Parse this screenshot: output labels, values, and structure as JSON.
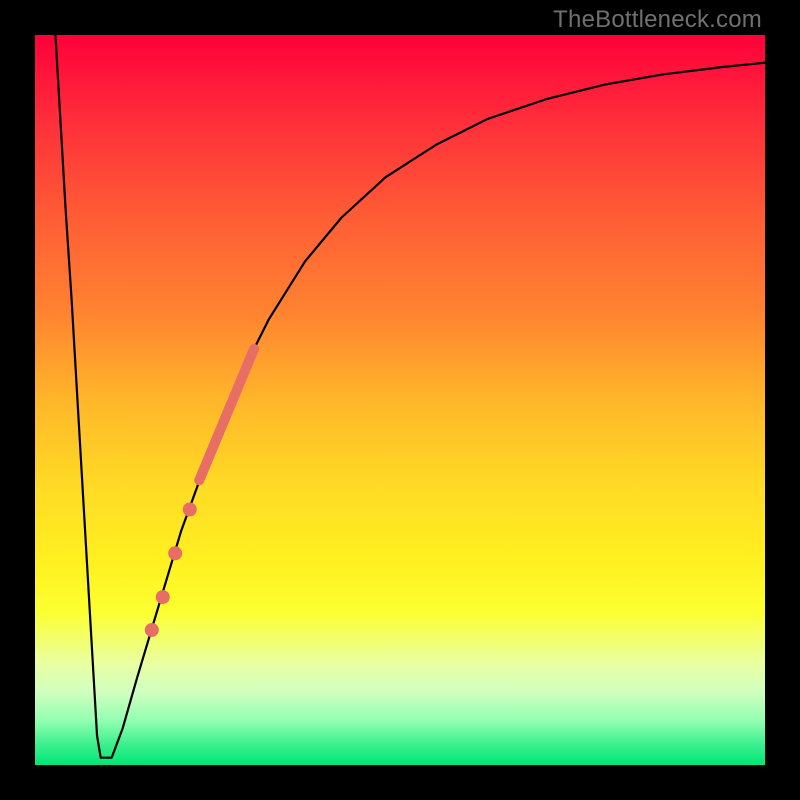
{
  "watermark": "TheBottleneck.com",
  "chart_data": {
    "type": "line",
    "title": "",
    "xlabel": "",
    "ylabel": "",
    "xlim": [
      0,
      100
    ],
    "ylim": [
      0,
      100
    ],
    "background": {
      "type": "vertical-gradient",
      "stops": [
        {
          "pos": 0.0,
          "color": "#ff003a"
        },
        {
          "pos": 0.12,
          "color": "#ff2f3a"
        },
        {
          "pos": 0.25,
          "color": "#ff5d35"
        },
        {
          "pos": 0.38,
          "color": "#ff8330"
        },
        {
          "pos": 0.5,
          "color": "#ffb62a"
        },
        {
          "pos": 0.62,
          "color": "#ffdb25"
        },
        {
          "pos": 0.72,
          "color": "#fff020"
        },
        {
          "pos": 0.79,
          "color": "#fcff30"
        },
        {
          "pos": 0.86,
          "color": "#eaffa0"
        },
        {
          "pos": 0.9,
          "color": "#d0ffc0"
        },
        {
          "pos": 0.94,
          "color": "#90ffb0"
        },
        {
          "pos": 0.97,
          "color": "#40f090"
        },
        {
          "pos": 1.0,
          "color": "#00e676"
        }
      ]
    },
    "frame": "black",
    "series": [
      {
        "name": "bottleneck-curve",
        "type": "line",
        "color": "#000000",
        "points": [
          {
            "x": 2.8,
            "y": 100.0
          },
          {
            "x": 3.5,
            "y": 88.0
          },
          {
            "x": 4.2,
            "y": 76.0
          },
          {
            "x": 5.0,
            "y": 64.0
          },
          {
            "x": 5.7,
            "y": 52.0
          },
          {
            "x": 6.4,
            "y": 40.0
          },
          {
            "x": 7.1,
            "y": 28.0
          },
          {
            "x": 7.8,
            "y": 16.0
          },
          {
            "x": 8.5,
            "y": 4.0
          },
          {
            "x": 9.0,
            "y": 1.0
          },
          {
            "x": 10.5,
            "y": 1.0
          },
          {
            "x": 12.0,
            "y": 5.0
          },
          {
            "x": 14.0,
            "y": 12.0
          },
          {
            "x": 17.0,
            "y": 22.0
          },
          {
            "x": 20.0,
            "y": 32.0
          },
          {
            "x": 24.0,
            "y": 43.0
          },
          {
            "x": 28.0,
            "y": 53.0
          },
          {
            "x": 32.0,
            "y": 61.0
          },
          {
            "x": 37.0,
            "y": 69.0
          },
          {
            "x": 42.0,
            "y": 75.0
          },
          {
            "x": 48.0,
            "y": 80.5
          },
          {
            "x": 55.0,
            "y": 85.0
          },
          {
            "x": 62.0,
            "y": 88.5
          },
          {
            "x": 70.0,
            "y": 91.2
          },
          {
            "x": 78.0,
            "y": 93.2
          },
          {
            "x": 86.0,
            "y": 94.6
          },
          {
            "x": 94.0,
            "y": 95.6
          },
          {
            "x": 100.0,
            "y": 96.2
          }
        ]
      },
      {
        "name": "highlight-segment",
        "type": "line-thick",
        "color": "#e76d65",
        "width": 10,
        "points": [
          {
            "x": 22.5,
            "y": 39.0
          },
          {
            "x": 30.0,
            "y": 57.0
          }
        ]
      },
      {
        "name": "highlight-dots",
        "type": "scatter",
        "color": "#e76d65",
        "radius": 7,
        "points": [
          {
            "x": 21.2,
            "y": 35.0
          },
          {
            "x": 19.2,
            "y": 29.0
          },
          {
            "x": 17.5,
            "y": 23.0
          },
          {
            "x": 16.0,
            "y": 18.5
          }
        ]
      }
    ]
  }
}
